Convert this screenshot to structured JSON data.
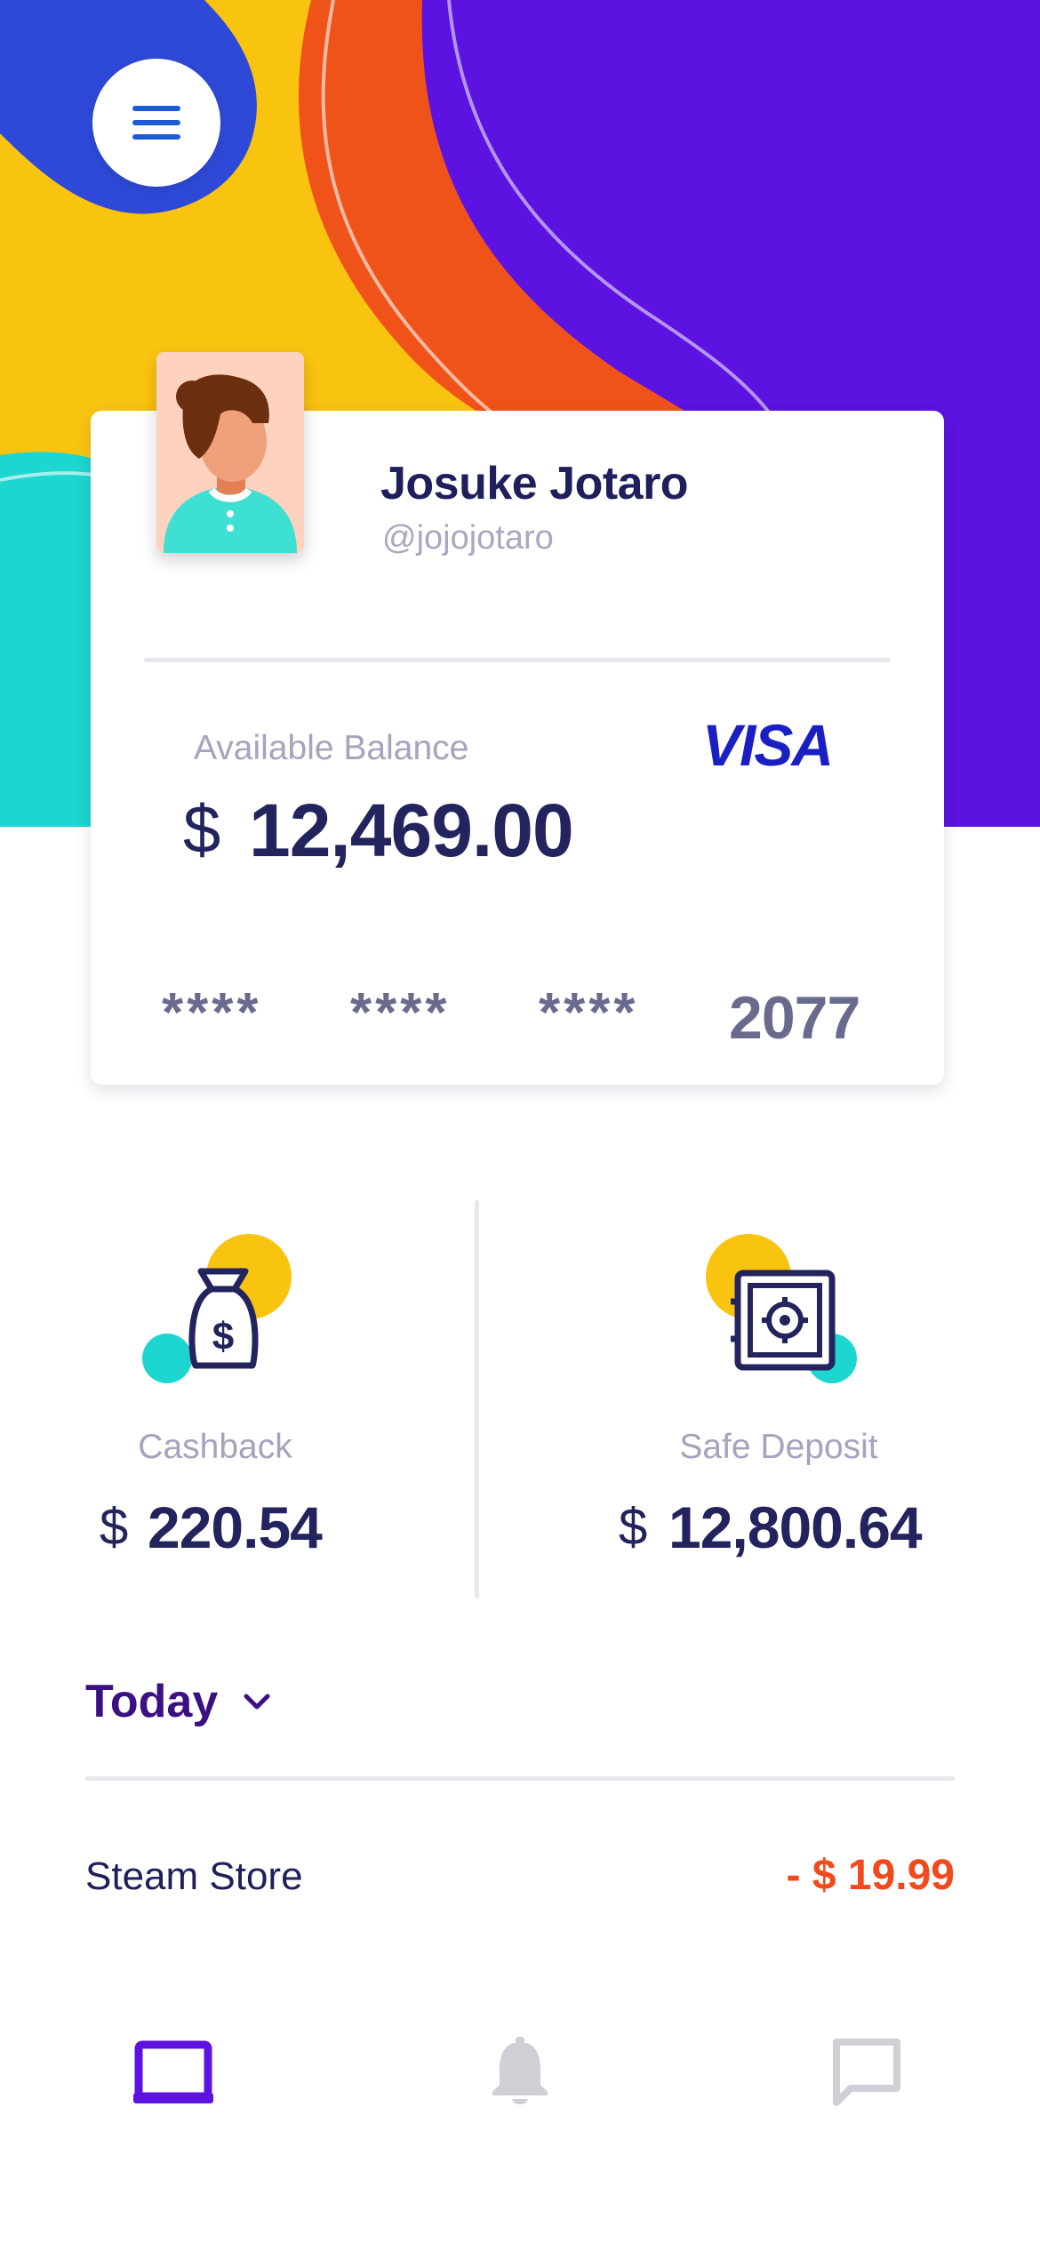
{
  "profile": {
    "name": "Josuke Jotaro",
    "handle": "@jojojotaro"
  },
  "balance": {
    "label": "Available Balance",
    "currency": "$",
    "amount": "12,469.00",
    "card_brand": "VISA",
    "masked_groups": [
      "****",
      "****",
      "****"
    ],
    "last4": "2077"
  },
  "stats": [
    {
      "label": "Cashback",
      "currency": "$",
      "amount": "220.54",
      "icon": "money-bag-icon"
    },
    {
      "label": "Safe Deposit",
      "currency": "$",
      "amount": "12,800.64",
      "icon": "safe-icon"
    }
  ],
  "period": {
    "selected": "Today",
    "icon": "chevron-down-icon"
  },
  "transactions": [
    {
      "name": "Steam Store",
      "amount": "- $ 19.99"
    }
  ],
  "nav": [
    {
      "name": "wallet",
      "icon": "laptop-icon",
      "active": true
    },
    {
      "name": "notifications",
      "icon": "bell-icon",
      "active": false
    },
    {
      "name": "messages",
      "icon": "chat-icon",
      "active": false
    }
  ],
  "colors": {
    "purple": "#5c12e0",
    "orange": "#f0531a",
    "yellow": "#f9c410",
    "teal": "#1dd6cf",
    "blue": "#2e49d8",
    "navy": "#23235e",
    "debit_red": "#f04a1d"
  }
}
